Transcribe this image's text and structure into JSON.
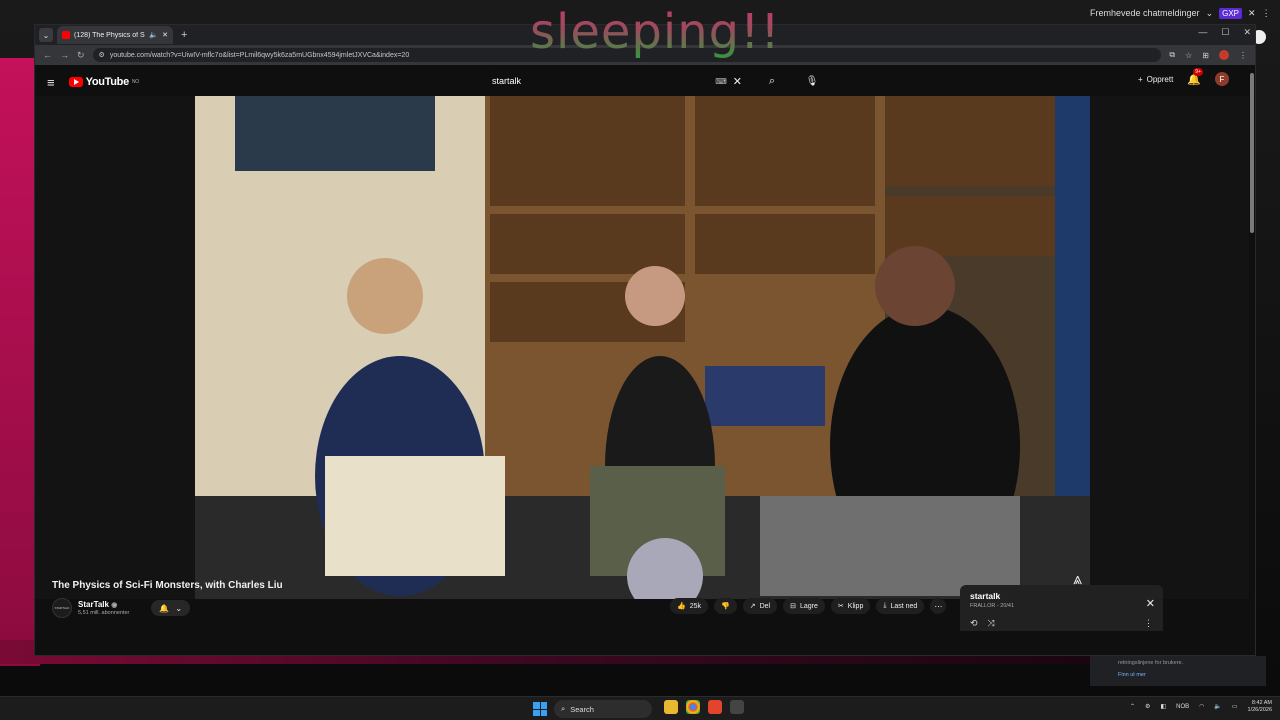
{
  "overlay": {
    "text": "sleeping!!"
  },
  "chat": {
    "label": "Fremhevede chatmeldinger",
    "badge": "GXP"
  },
  "browser": {
    "tab_title": "(128) The Physics of Sci-Fi M",
    "url": "youtube.com/watch?v=UiwIV-mflc7o&list=PLmil6qwy5k6za5mUGbnx4594jmletJXVCa&index=20"
  },
  "youtube": {
    "logo": "YouTube",
    "logo_country": "NO",
    "search_value": "startalk",
    "create_label": "Opprett",
    "notif_count": "9+",
    "avatar_letter": "F"
  },
  "video": {
    "title": "The Physics of Sci-Fi Monsters, with Charles Liu"
  },
  "channel": {
    "name": "StarTalk",
    "subscribers": "5,51 mill. abonnenter",
    "avatar_text": "STARTALK"
  },
  "actions": {
    "like_count": "25k",
    "share": "Del",
    "save": "Lagre",
    "clip": "Klipp",
    "download": "Last ned"
  },
  "playlist": {
    "title": "startalk",
    "subtitle": "FRALLOR - 20/41"
  },
  "side_panel": {
    "text": "retningslinjene for brukere.",
    "link": "Finn ut mer"
  },
  "taskbar": {
    "search_label": "Search",
    "lang": "NOB",
    "time": "8:42 AM",
    "date": "1/26/2026"
  },
  "colors": {
    "yt_red": "#ff0000",
    "bg": "#0f0f0f",
    "accent_pink": "#c4115a"
  }
}
